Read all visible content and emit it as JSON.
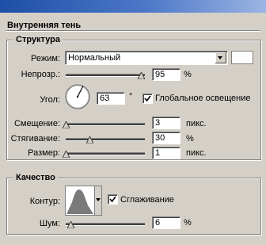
{
  "dialog": {
    "title": "Внутренняя тень"
  },
  "structure": {
    "legend": "Структура",
    "mode": {
      "label": "Режим:",
      "value": "Нормальный",
      "swatch_color": "#fdfdfd"
    },
    "opacity": {
      "label": "Непрозр.:",
      "value": "95",
      "unit": "%",
      "slider_fraction": 0.95
    },
    "angle": {
      "label": "Угол:",
      "value": "63",
      "unit": "°",
      "global_light_label": "Глобальное освещение",
      "global_light_checked": true
    },
    "distance": {
      "label": "Смещение:",
      "value": "3",
      "unit": "пикс.",
      "slider_fraction": 0.0
    },
    "choke": {
      "label": "Стягивание:",
      "value": "30",
      "unit": "%",
      "slider_fraction": 0.3
    },
    "size": {
      "label": "Размер:",
      "value": "1",
      "unit": "пикс.",
      "slider_fraction": 0.0
    }
  },
  "quality": {
    "legend": "Качество",
    "contour": {
      "label": "Контур:",
      "antialias_label": "Сглаживание",
      "antialias_checked": true
    },
    "noise": {
      "label": "Шум:",
      "value": "6",
      "unit": "%",
      "slider_fraction": 0.06
    }
  },
  "icons": {
    "angle_dial": "angle-dial-icon",
    "contour_preview": "contour-curve-icon",
    "checkmark": "checkmark-icon",
    "slider_thumb": "triangle-thumb-icon"
  },
  "colors": {
    "titlebar_start": "#1e4fa6",
    "titlebar_end": "#9cb4e2",
    "panel_bg": "#d4d0c8"
  }
}
